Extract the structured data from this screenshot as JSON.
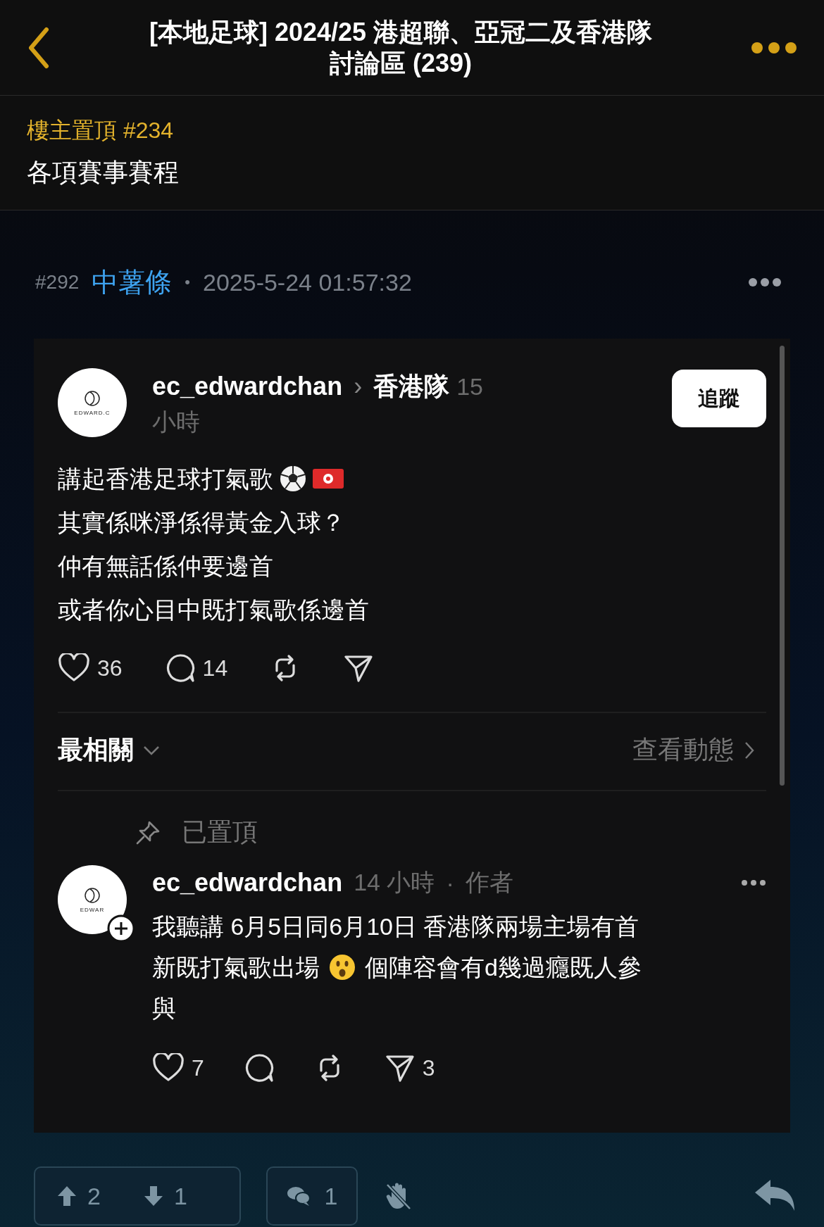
{
  "header": {
    "title_lines": [
      "[本地足球] 2024/25 港超聯、亞冠二及香港隊",
      "討論區 (239)"
    ]
  },
  "pinned": {
    "label": "樓主置頂 #234",
    "title": "各項賽事賽程"
  },
  "post": {
    "floor": "#292",
    "author": "中薯條",
    "separator": "•",
    "time": "2025-5-24 01:57:32"
  },
  "embed": {
    "thread": {
      "avatar_label": "EDWARD.C",
      "username": "ec_edwardchan",
      "arrow": "›",
      "topic": "香港隊",
      "time_lines": [
        "15",
        "小時"
      ],
      "follow": "追蹤",
      "lines": [
        "講起香港足球打氣歌",
        "其實係咪淨係得黃金入球？",
        "仲有無話係仲要邊首",
        "或者你心目中既打氣歌係邊首"
      ],
      "likes": "36",
      "comments": "14"
    },
    "sort": {
      "label": "最相關",
      "activity": "查看動態"
    },
    "reply": {
      "pinned_label": "已置頂",
      "avatar_label": "EDWAR",
      "username": "ec_edwardchan",
      "time": "14 小時",
      "separator": "·",
      "role": "作者",
      "body_lines": [
        [
          "我聽講 6月5日同6月10日 香港隊兩場主場有首"
        ],
        [
          "新既打氣歌出場",
          "個陣容會有d幾過癮既人參"
        ],
        [
          "與"
        ]
      ],
      "likes": "7",
      "shares": "3"
    }
  },
  "footer": {
    "upvotes": "2",
    "downvotes": "1",
    "comments": "1"
  }
}
